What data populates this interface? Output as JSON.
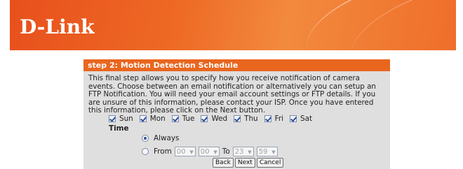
{
  "header": {
    "logo": "D-Link"
  },
  "panel": {
    "title": "step 2: Motion Detection Schedule",
    "description": "This final step allows you to specify how you receive notification of camera events. Choose between an email notification or alternatively you can setup an FTP Notification. You will need your email account settings or FTP details. If you are unsure of this information, please contact your ISP. Once you have entered this information, please click on the Next button."
  },
  "days": [
    {
      "label": "Sun",
      "checked": true
    },
    {
      "label": "Mon",
      "checked": true
    },
    {
      "label": "Tue",
      "checked": true
    },
    {
      "label": "Wed",
      "checked": true
    },
    {
      "label": "Thu",
      "checked": true
    },
    {
      "label": "Fri",
      "checked": true
    },
    {
      "label": "Sat",
      "checked": true
    }
  ],
  "time": {
    "label": "Time",
    "always_label": "Always",
    "from_label": "From",
    "to_label": "To",
    "from_hour": "00",
    "from_minute": "00",
    "to_hour": "23",
    "to_minute": "59",
    "selected": "Always"
  },
  "buttons": {
    "back": "Back",
    "next": "Next",
    "cancel": "Cancel"
  },
  "icons": {
    "checkbox": "checkbox-checked-icon",
    "radio": "radio-icon",
    "dropdown": "chevron-down-icon"
  }
}
